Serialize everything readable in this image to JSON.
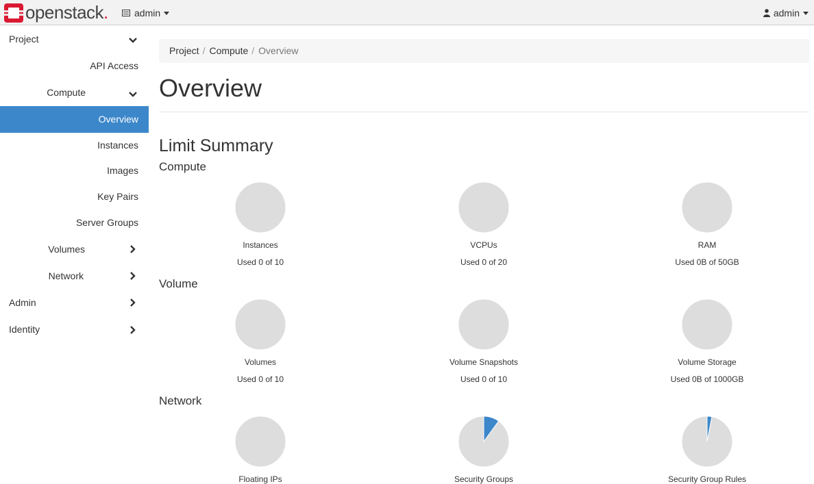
{
  "brand": {
    "name": "openstack",
    "dot": ".",
    "accent_color": "#da1a32"
  },
  "topbar": {
    "project_switcher": "admin",
    "project_icon": "server-icon",
    "user_menu": "admin",
    "user_icon": "user-icon"
  },
  "sidebar": {
    "project": "Project",
    "api_access": "API Access",
    "compute": "Compute",
    "overview": "Overview",
    "instances": "Instances",
    "images": "Images",
    "key_pairs": "Key Pairs",
    "server_groups": "Server Groups",
    "volumes": "Volumes",
    "network": "Network",
    "admin": "Admin",
    "identity": "Identity",
    "active_color": "#3c87ca"
  },
  "breadcrumb": {
    "project": "Project",
    "compute": "Compute",
    "current": "Overview",
    "sep": "/"
  },
  "page_title": "Overview",
  "limit_summary": "Limit Summary",
  "sections": {
    "compute": "Compute",
    "volume": "Volume",
    "network": "Network"
  },
  "charts": {
    "instances": {
      "name": "Instances",
      "usage": "Used 0 of 10",
      "fraction": 0
    },
    "vcpus": {
      "name": "VCPUs",
      "usage": "Used 0 of 20",
      "fraction": 0
    },
    "ram": {
      "name": "RAM",
      "usage": "Used 0B of 50GB",
      "fraction": 0
    },
    "volumes": {
      "name": "Volumes",
      "usage": "Used 0 of 10",
      "fraction": 0
    },
    "volume_snapshots": {
      "name": "Volume Snapshots",
      "usage": "Used 0 of 10",
      "fraction": 0
    },
    "volume_storage": {
      "name": "Volume Storage",
      "usage": "Used 0B of 1000GB",
      "fraction": 0
    },
    "floating_ips": {
      "name": "Floating IPs",
      "fraction": 0
    },
    "security_groups": {
      "name": "Security Groups",
      "fraction": 0.1
    },
    "security_group_rules": {
      "name": "Security Group Rules",
      "fraction": 0.03
    }
  },
  "colors": {
    "pie_empty": "#dddddd",
    "pie_used": "#3c87ca"
  }
}
